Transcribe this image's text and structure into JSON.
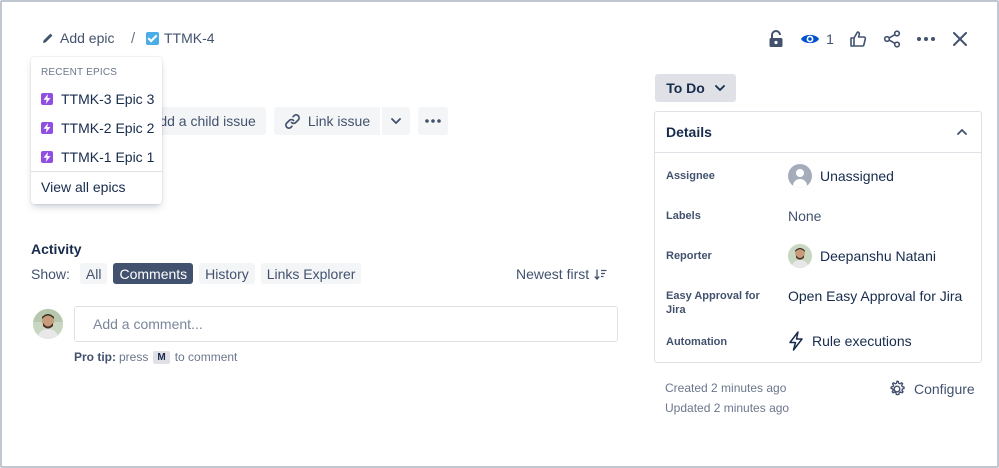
{
  "breadcrumb": {
    "add_epic_label": "Add epic",
    "separator": "/",
    "issue_key": "TTMK-4"
  },
  "top_actions": {
    "watchers_count": "1"
  },
  "toolbar": {
    "add_child_label": "Add a child issue",
    "link_issue_label": "Link issue"
  },
  "epic_dropdown": {
    "heading": "RECENT EPICS",
    "items": [
      {
        "label": "TTMK-3 Epic 3"
      },
      {
        "label": "TTMK-2 Epic 2"
      },
      {
        "label": "TTMK-1 Epic 1"
      }
    ],
    "view_all_label": "View all epics"
  },
  "activity": {
    "title": "Activity",
    "show_label": "Show:",
    "filters": [
      "All",
      "Comments",
      "History",
      "Links Explorer"
    ],
    "active_filter": "Comments",
    "sort_label": "Newest first",
    "comment_placeholder": "Add a comment...",
    "protip_bold": "Pro tip:",
    "protip_press": "press",
    "protip_key": "M",
    "protip_rest": "to comment"
  },
  "status": {
    "label": "To Do"
  },
  "details": {
    "title": "Details",
    "fields": [
      {
        "label": "Assignee",
        "value": "Unassigned"
      },
      {
        "label": "Labels",
        "value": "None"
      },
      {
        "label": "Reporter",
        "value": "Deepanshu Natani"
      },
      {
        "label": "Easy Approval for Jira",
        "value": "Open Easy Approval for Jira"
      },
      {
        "label": "Automation",
        "value": "Rule executions"
      }
    ]
  },
  "meta": {
    "created": "Created 2 minutes ago",
    "updated": "Updated 2 minutes ago",
    "configure_label": "Configure"
  },
  "colors": {
    "epic_purple": "#904ee2",
    "task_blue": "#4bade8",
    "active_pill": "#42526e"
  }
}
